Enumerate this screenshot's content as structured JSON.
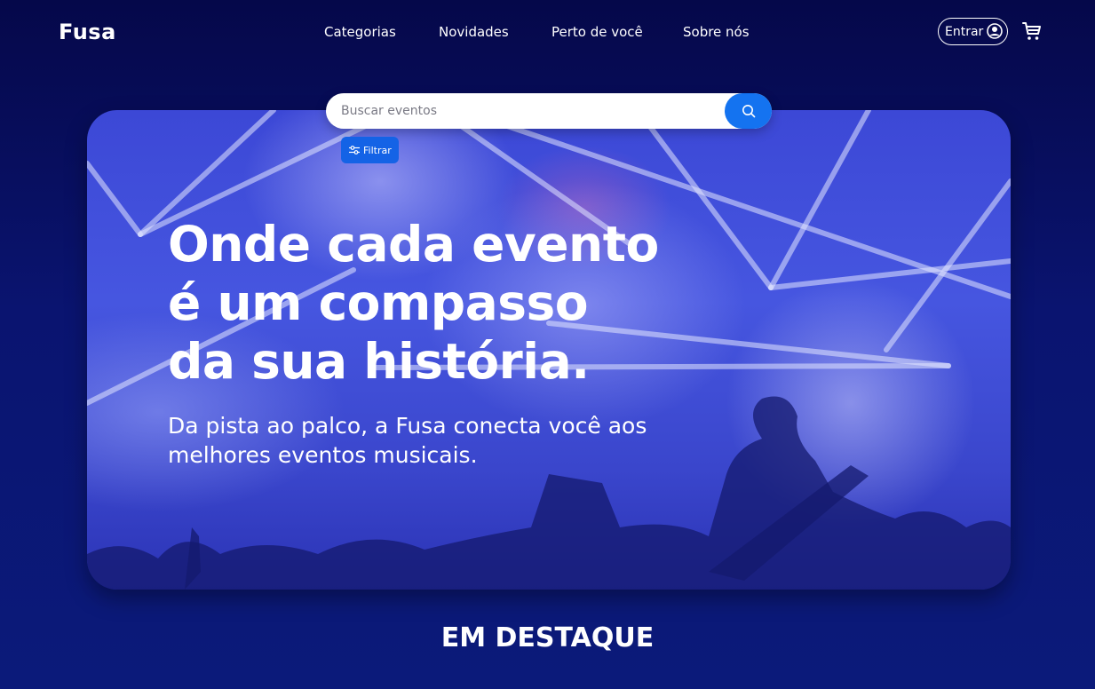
{
  "header": {
    "logo": "Fusa",
    "nav": [
      {
        "label": "Categorias"
      },
      {
        "label": "Novidades"
      },
      {
        "label": "Perto de você"
      },
      {
        "label": "Sobre nós"
      }
    ],
    "login_label": "Entrar",
    "icons": {
      "user": "user-circle-icon",
      "cart": "shopping-cart-icon"
    }
  },
  "search": {
    "placeholder": "Buscar eventos",
    "value": "",
    "button_icon": "search-icon",
    "filter_label": "Filtrar",
    "filter_icon": "sliders-icon"
  },
  "hero": {
    "title": "Onde cada evento é um compasso da sua história.",
    "subtitle": "Da pista ao palco, a Fusa conecta você aos melhores eventos musicais."
  },
  "featured": {
    "title": "EM DESTAQUE"
  },
  "colors": {
    "background": "#05084a",
    "accent": "#1473f0",
    "hero_tint": "#3c48d6"
  }
}
